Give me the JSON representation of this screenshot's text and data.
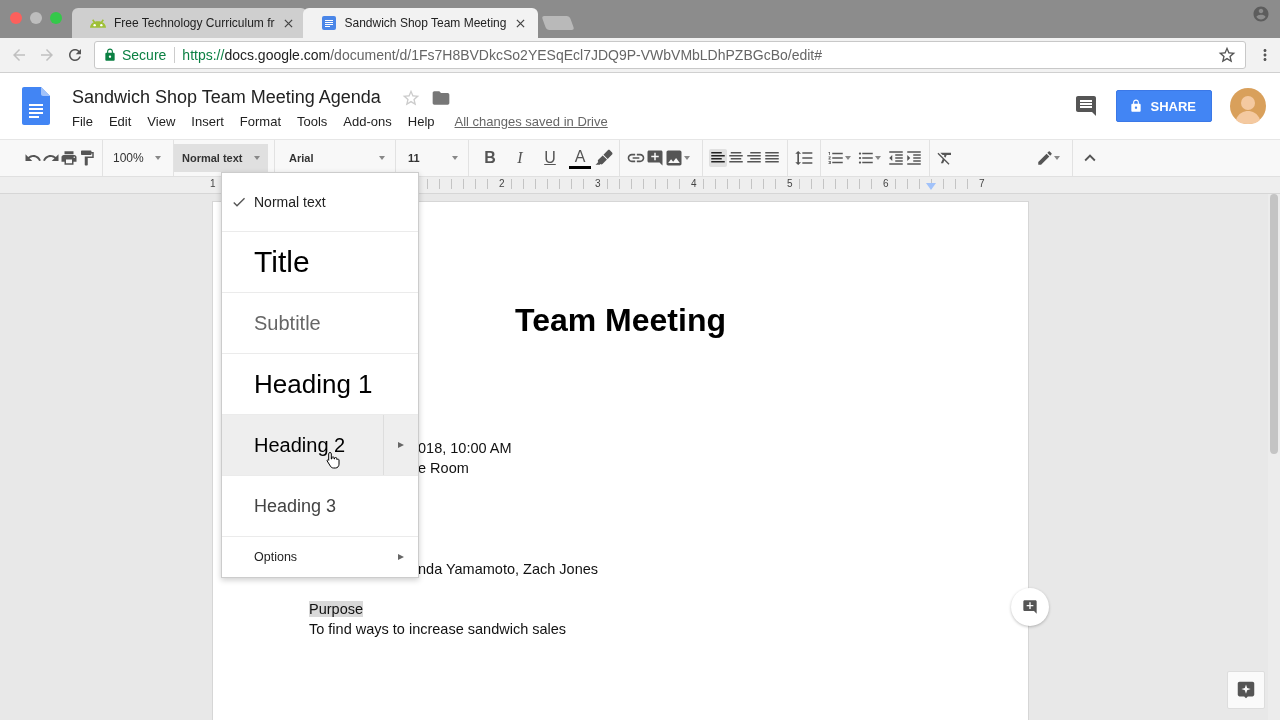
{
  "browser": {
    "tabs": [
      {
        "kind": "android",
        "title": "Free Technology Curriculum fr",
        "selected": false
      },
      {
        "kind": "docs",
        "title": "Sandwich Shop Team Meeting",
        "selected": true
      }
    ],
    "address_bar": {
      "security_label": "Secure",
      "url_scheme": "https://",
      "url_host": "docs.google.com",
      "url_path": "/document/d/1Fs7H8BVDkcSo2YESqEcl7JDQ9P-VWbVMbLDhPZBGcBo/edit#"
    }
  },
  "docs_header": {
    "title": "Sandwich Shop Team Meeting Agenda",
    "starred": false,
    "menu": [
      "File",
      "Edit",
      "View",
      "Insert",
      "Format",
      "Tools",
      "Add-ons",
      "Help"
    ],
    "save_status": "All changes saved in Drive",
    "share_button": "SHARE"
  },
  "toolbar": {
    "zoom": "100%",
    "paragraph_style": "Normal text",
    "style_menu_open": true,
    "font": "Arial",
    "font_size": "11",
    "format_buttons": [
      {
        "kind": "bold",
        "label": "B"
      },
      {
        "kind": "italic",
        "label": "I"
      },
      {
        "kind": "underline",
        "label": "U"
      },
      {
        "kind": "text_color",
        "label": "A"
      }
    ],
    "align_buttons": [
      {
        "kind": "left",
        "selected": true
      },
      {
        "kind": "center",
        "selected": false
      },
      {
        "kind": "right",
        "selected": false
      },
      {
        "kind": "justify",
        "selected": false
      }
    ]
  },
  "ruler": {
    "labels": [
      "1",
      "2",
      "3",
      "4",
      "5",
      "6",
      "7"
    ]
  },
  "document": {
    "lines": [
      {
        "kind": "title",
        "text": "Team Meeting"
      },
      {
        "kind": "partial",
        "text": "018, 10:00 AM"
      },
      {
        "kind": "partial",
        "text": "e Room"
      },
      {
        "kind": "partial",
        "text": "nda Yamamoto, Zach Jones"
      },
      {
        "kind": "highlighted",
        "text": "Purpose"
      },
      {
        "kind": "body",
        "text": "To find ways to increase sandwich sales"
      }
    ]
  },
  "style_menu": {
    "items": [
      {
        "kind": "normal",
        "label": "Normal text",
        "checked": true,
        "highlighted": false,
        "submenu": false
      },
      {
        "kind": "title",
        "label": "Title",
        "checked": false,
        "highlighted": false,
        "submenu": false
      },
      {
        "kind": "subtitle",
        "label": "Subtitle",
        "checked": false,
        "highlighted": false,
        "submenu": false
      },
      {
        "kind": "heading1",
        "label": "Heading 1",
        "checked": false,
        "highlighted": false,
        "submenu": false
      },
      {
        "kind": "heading2",
        "label": "Heading 2",
        "checked": false,
        "highlighted": true,
        "submenu": true
      },
      {
        "kind": "heading3",
        "label": "Heading 3",
        "checked": false,
        "highlighted": false,
        "submenu": false
      },
      {
        "kind": "options",
        "label": "Options",
        "checked": false,
        "highlighted": false,
        "submenu": true
      }
    ]
  }
}
